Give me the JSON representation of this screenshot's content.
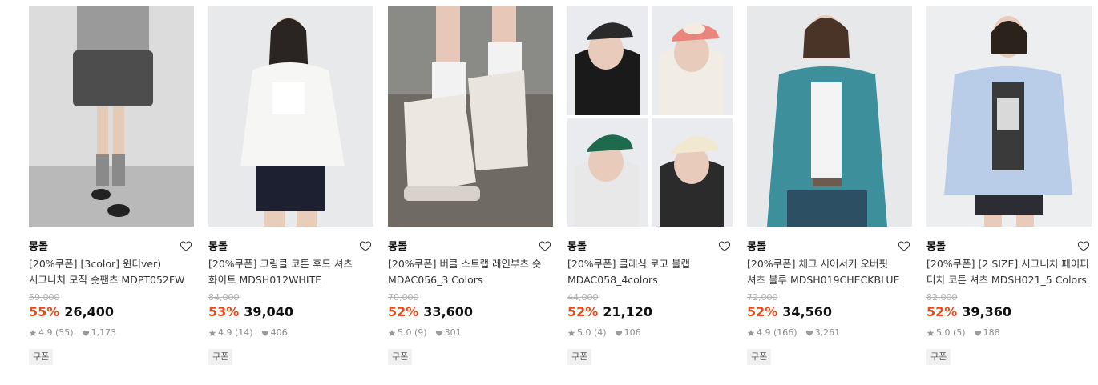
{
  "products": [
    {
      "brand": "몽돌",
      "title_line1": "[20%쿠폰] [3color] 윈터ver)",
      "title_line2": "시그니처 모직 숏팬츠 MDPT052FW",
      "original_price": "59,000",
      "discount": "55%",
      "price": "26,400",
      "rating": "4.9",
      "reviews": "(55)",
      "likes": "1,173",
      "badge": "쿠폰",
      "image": "model-grey-wool-shorts"
    },
    {
      "brand": "몽돌",
      "title_line1": "[20%쿠폰] 크링클 코튼 후드 셔츠",
      "title_line2": "화이트 MDSH012WHITE",
      "original_price": "84,000",
      "discount": "53%",
      "price": "39,040",
      "rating": "4.9",
      "reviews": "(14)",
      "likes": "406",
      "badge": "쿠폰",
      "image": "model-white-hood-shirt"
    },
    {
      "brand": "몽돌",
      "title_line1": "[20%쿠폰] 버클 스트랩 레인부츠 숏",
      "title_line2": "MDAC056_3 Colors",
      "original_price": "70,000",
      "discount": "52%",
      "price": "33,600",
      "rating": "5.0",
      "reviews": "(9)",
      "likes": "301",
      "badge": "쿠폰",
      "image": "ivory-rain-boots"
    },
    {
      "brand": "몽돌",
      "title_line1": "[20%쿠폰] 클래식 로고 볼캡",
      "title_line2": "MDAC058_4colors",
      "original_price": "44,000",
      "discount": "52%",
      "price": "21,120",
      "rating": "5.0",
      "reviews": "(4)",
      "likes": "106",
      "badge": "쿠폰",
      "image": "four-ballcaps-grid"
    },
    {
      "brand": "몽돌",
      "title_line1": "[20%쿠폰] 체크 시어서커 오버핏",
      "title_line2": "셔츠 블루 MDSH019CHECKBLUE",
      "original_price": "72,000",
      "discount": "52%",
      "price": "34,560",
      "rating": "4.9",
      "reviews": "(166)",
      "likes": "3,261",
      "badge": "쿠폰",
      "image": "model-teal-check-shirt"
    },
    {
      "brand": "몽돌",
      "title_line1": "[20%쿠폰] [2 SIZE] 시그니처 페이퍼",
      "title_line2": "터치 코튼 셔츠 MDSH021_5 Colors",
      "original_price": "82,000",
      "discount": "52%",
      "price": "39,360",
      "rating": "5.0",
      "reviews": "(5)",
      "likes": "188",
      "badge": "쿠폰",
      "image": "model-blue-cotton-shirt"
    }
  ],
  "colors": {
    "discount": "#f04a1a",
    "strike": "#b0b0b0",
    "meta": "#8c8c8c"
  }
}
